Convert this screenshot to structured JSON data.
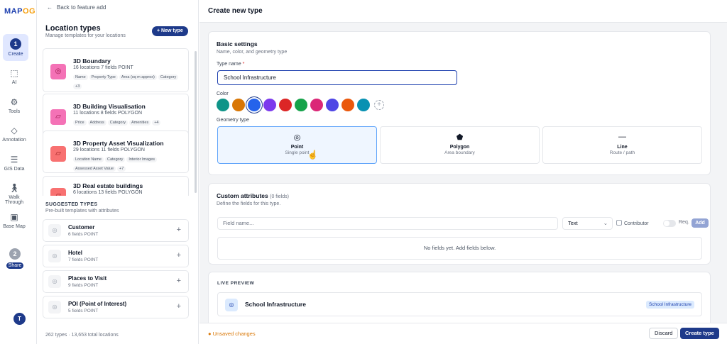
{
  "app": {
    "logo_main": "MAP",
    "logo_accent": "OG",
    "collapse_icon": "chevron-right"
  },
  "rail": {
    "create": {
      "step": "1",
      "label": "Create"
    },
    "items": [
      {
        "label": "AI",
        "icon": "ai-icon"
      },
      {
        "label": "Tools",
        "icon": "gear-icon"
      },
      {
        "label": "Annotation",
        "icon": "bucket-icon"
      },
      {
        "label": "GIS Data",
        "icon": "layers-icon"
      },
      {
        "label": "Walk Through",
        "icon": "walking-icon"
      },
      {
        "label": "Base Map",
        "icon": "map-icon"
      }
    ],
    "share": {
      "step": "2",
      "label": "Share"
    },
    "avatar": "T"
  },
  "sidebar": {
    "back_label": "Back to feature add",
    "title": "Location types",
    "subtitle": "Manage templates for your locations",
    "new_type_label": "+ New type",
    "types": [
      {
        "name": "3D Boundary",
        "meta": "16 locations   7 fields   POINT",
        "tags": [
          "Name",
          "Property Type",
          "Area (sq m approx)",
          "Category",
          "+3"
        ]
      },
      {
        "name": "3D Building Visualisation",
        "meta": "11 locations   8 fields   POLYGON",
        "tags": [
          "Price",
          "Address",
          "Category",
          "Amenities",
          "+4"
        ]
      },
      {
        "name": "3D Property Asset Visualization",
        "meta": "29 locations   11 fields   POLYGON",
        "tags": [
          "Location Name",
          "Category",
          "Interior Images",
          "Assessed Asset Value",
          "+7"
        ]
      },
      {
        "name": "3D Real estate buildings",
        "meta": "6 locations   13 fields   POLYGON",
        "tags": []
      }
    ],
    "suggested_heading": "SUGGESTED TYPES",
    "suggested_sub": "Pre-built templates with attributes",
    "suggested": [
      {
        "name": "Customer",
        "meta": "6 fields   POINT"
      },
      {
        "name": "Hotel",
        "meta": "7 fields   POINT"
      },
      {
        "name": "Places to Visit",
        "meta": "9 fields   POINT"
      },
      {
        "name": "POI (Point of Interest)",
        "meta": "5 fields   POINT"
      }
    ],
    "footer": "262 types · 13,653 total locations"
  },
  "main": {
    "title": "Create new type",
    "basic": {
      "title": "Basic settings",
      "subtitle": "Name, color, and geometry type",
      "type_name_label": "Type name",
      "type_name_value": "School Infrastructure",
      "color_label": "Color",
      "colors": [
        "#0f9488",
        "#d97706",
        "#2563eb",
        "#7c3aed",
        "#dc2626",
        "#16a34a",
        "#db2777",
        "#4f46e5",
        "#ea580c",
        "#0891b2"
      ],
      "selected_color_index": 2,
      "geometry_label": "Geometry type",
      "geometries": [
        {
          "name": "Point",
          "desc": "Single point",
          "selected": true
        },
        {
          "name": "Polygon",
          "desc": "Area boundary",
          "selected": false
        },
        {
          "name": "Line",
          "desc": "Route / path",
          "selected": false
        }
      ]
    },
    "attributes": {
      "title": "Custom attributes",
      "count": "(0 fields)",
      "subtitle": "Define the fields for this type.",
      "field_placeholder": "Field name...",
      "type_value": "Text",
      "contributor_label": "Contributor",
      "req_label": "Req.",
      "add_label": "Add",
      "empty_text": "No fields yet. Add fields below."
    },
    "preview": {
      "label": "LIVE PREVIEW",
      "name": "School Infrastructure",
      "badge": "School Infrastructure"
    },
    "footer": {
      "unsaved": "● Unsaved changes",
      "discard": "Discard",
      "create": "Create type"
    }
  }
}
